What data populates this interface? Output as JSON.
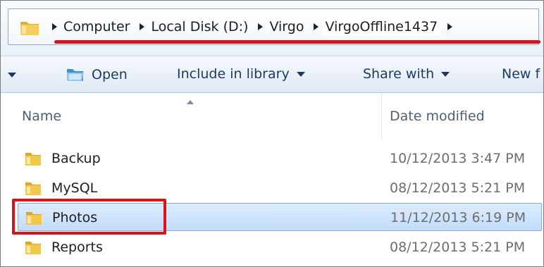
{
  "address_bar": {
    "breadcrumbs": [
      "Computer",
      "Local Disk (D:)",
      "Virgo",
      "VirgoOffline1437"
    ]
  },
  "toolbar": {
    "open_label": "Open",
    "include_label": "Include in library",
    "share_label": "Share with",
    "new_folder_label": "New f"
  },
  "columns": {
    "name": "Name",
    "date_modified": "Date modified"
  },
  "files": [
    {
      "name": "Backup",
      "date": "10/12/2013 3:47 PM"
    },
    {
      "name": "MySQL",
      "date": "08/12/2013 5:21 PM"
    },
    {
      "name": "Photos",
      "date": "11/12/2013 6:19 PM",
      "selected": true
    },
    {
      "name": "Reports",
      "date": "08/12/2013 5:21 PM"
    }
  ],
  "colors": {
    "highlight_red": "#d7141a",
    "selection_blue": "#c2dcfb",
    "folder_yellow": "#f2c84b"
  },
  "icons": {
    "address": "folder-icon",
    "open": "open-folder-icon",
    "files": "folder-icon"
  }
}
